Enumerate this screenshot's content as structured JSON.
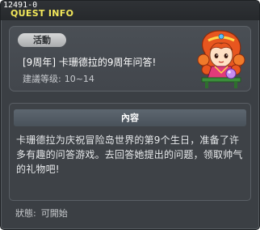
{
  "window": {
    "quest_id": "12491-0",
    "title": "QUEST INFO"
  },
  "quest": {
    "badge": "活動",
    "name": "[9周年] 卡珊德拉的9周年问答!",
    "level_label": "建議等级:",
    "level_value": "10~14"
  },
  "description": {
    "header": "內容",
    "text": "卡珊德拉为庆祝冒险岛世界的第9个生日，准备了许多有趣的问答游戏。去回答她提出的问题，领取帅气的礼物吧!"
  },
  "status": {
    "label": "狀態:",
    "value": "可開始"
  },
  "npc": {
    "icon": "cassandra-npc-sprite",
    "hair_color": "#e8561f",
    "dress_color": "#e23a7a",
    "orb_color": "#c88cf0"
  }
}
